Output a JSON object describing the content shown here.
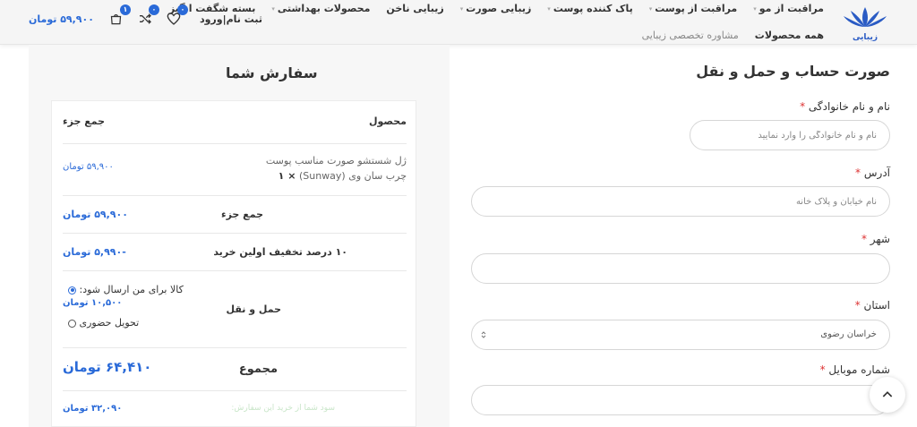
{
  "header": {
    "nav_top": [
      {
        "label": "مراقبت از مو",
        "chevron": true
      },
      {
        "label": "مراقبت از پوست",
        "chevron": true
      },
      {
        "label": "پاک کننده پوست",
        "chevron": true
      },
      {
        "label": "زیبایی صورت",
        "chevron": true
      },
      {
        "label": "زیبایی ناخن",
        "chevron": false
      },
      {
        "label": "محصولات بهداشتی",
        "chevron": true
      },
      {
        "label": "بسته شگفت انگیز",
        "chevron": false
      }
    ],
    "nav_sub": [
      {
        "label": "همه محصولات"
      },
      {
        "label": "مشاوره تخصصی زیبایی"
      }
    ],
    "login_label": "ثبت نام|ورود",
    "wishlist_count": "۰",
    "compare_count": "۰",
    "cart_count": "۱",
    "cart_total": "۵۹,۹۰۰ تومان",
    "logo_text": "زیبایی",
    "accent": "#2a6ad8"
  },
  "order": {
    "title": "سفارش شما",
    "col_product": "محصول",
    "col_subtotal": "جمع جزء",
    "item_name_line1": "ژل شستشو صورت مناسب پوست",
    "item_name_line2": "چرب سان وی (Sunway)",
    "item_qty": "× ۱",
    "item_price": "۵۹,۹۰۰ تومان",
    "subtotal_label": "جمع جزء",
    "subtotal_value": "۵۹,۹۰۰ تومان",
    "discount_label": "۱۰ درصد تخفیف اولین خرید",
    "discount_value": "-۵,۹۹۰ تومان",
    "shipping_label": "حمل و نقل",
    "shipping_option1": "کالا برای من ارسال شود:",
    "shipping_option1_price": "۱۰,۵۰۰ تومان",
    "shipping_option2": "تحویل حضوری",
    "total_label": "مجموع",
    "total_value": "۶۴,۴۱۰ تومان",
    "savings_label": "سود شما از خرید این سفارش:",
    "savings_value": "۳۲,۰۹۰ تومان"
  },
  "form": {
    "title": "صورت حساب و حمل و نقل",
    "name_label": "نام و نام خانوادگی",
    "name_placeholder": "نام و نام خانوادگی را وارد نمایید",
    "address_label": "آدرس",
    "address_placeholder": "نام خیابان و پلاک خانه",
    "city_label": "شهر",
    "city_value": "",
    "state_label": "استان",
    "state_value": "خراسان رضوی",
    "mobile_label": "شماره موبایل",
    "mobile_value": "",
    "required_mark": "*"
  }
}
